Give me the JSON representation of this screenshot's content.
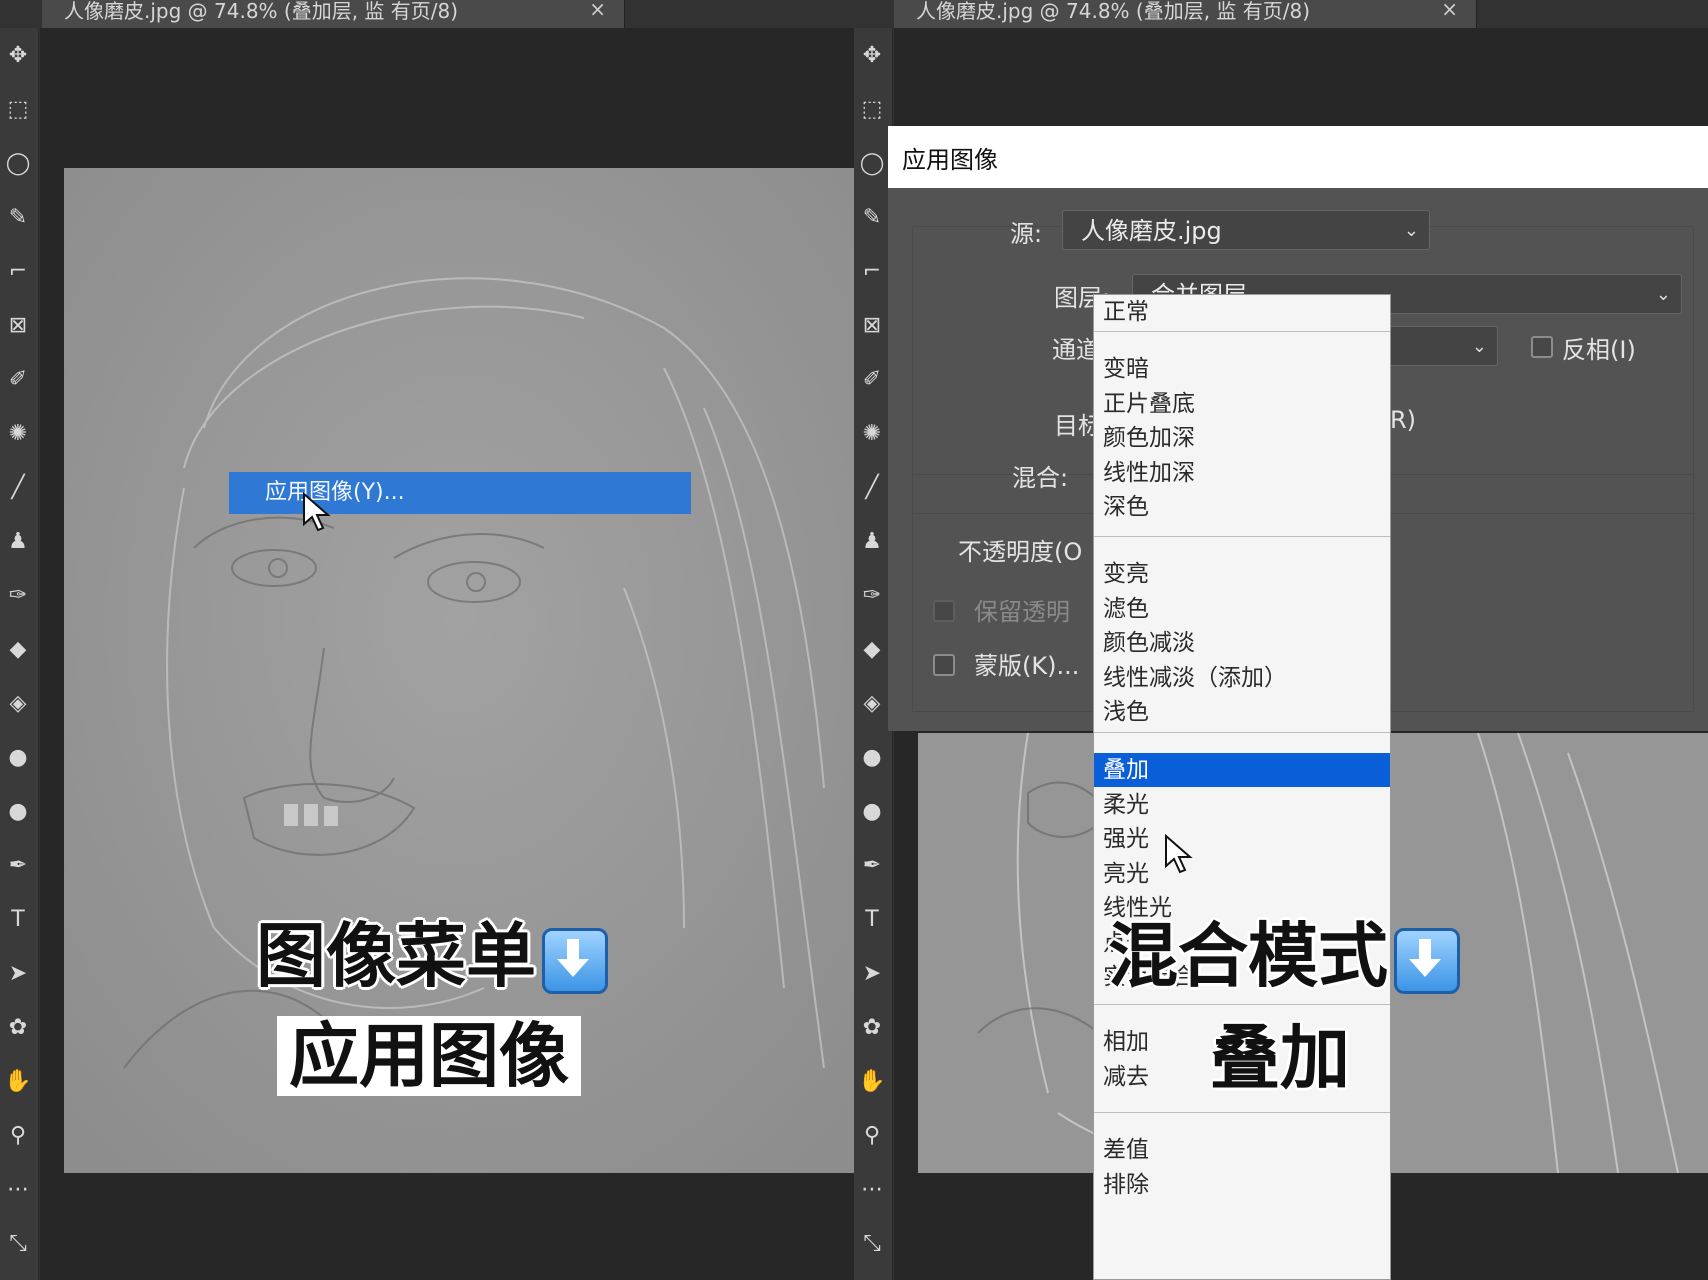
{
  "left": {
    "tab_title": "人像磨皮.jpg @ 74.8% (叠加层, 监 有页/8)",
    "context_item": "应用图像(Y)...",
    "caption_line1": "图像菜单",
    "caption_line2": "应用图像"
  },
  "right": {
    "tab_title": "人像磨皮.jpg @ 74.8% (叠加层, 监 有页/8)",
    "caption_line1": "混合模式",
    "caption_line2": "叠加"
  },
  "dialog": {
    "title": "应用图像",
    "source_label": "源:",
    "source_value": "人像磨皮.jpg",
    "layer_label": "图层:",
    "layer_value": "合并图层",
    "channel_label": "通道",
    "invert_label": "反相(I)",
    "target_label": "目标",
    "target_suffix": "R)",
    "blend_label": "混合:",
    "opacity_label": "不透明度(O",
    "preserve_label": "保留透明",
    "mask_label": "蒙版(K)..."
  },
  "blend_modes": {
    "selected": "叠加",
    "groups": [
      [
        "正常"
      ],
      [
        "变暗",
        "正片叠底",
        "颜色加深",
        "线性加深",
        "深色"
      ],
      [
        "变亮",
        "滤色",
        "颜色减淡",
        "线性减淡（添加）",
        "浅色"
      ],
      [
        "叠加",
        "柔光",
        "强光",
        "亮光",
        "线性光",
        "点光",
        "实色混合"
      ],
      [
        "相加",
        "减去"
      ],
      [
        "差值",
        "排除"
      ]
    ]
  },
  "icons": {
    "tab_close": "×",
    "dropdown_chevron": "⌄"
  },
  "colors": {
    "highlight": "#2f79d4",
    "selected_option": "#0a5fd8",
    "arrow_emoji": "#3c94e6"
  }
}
